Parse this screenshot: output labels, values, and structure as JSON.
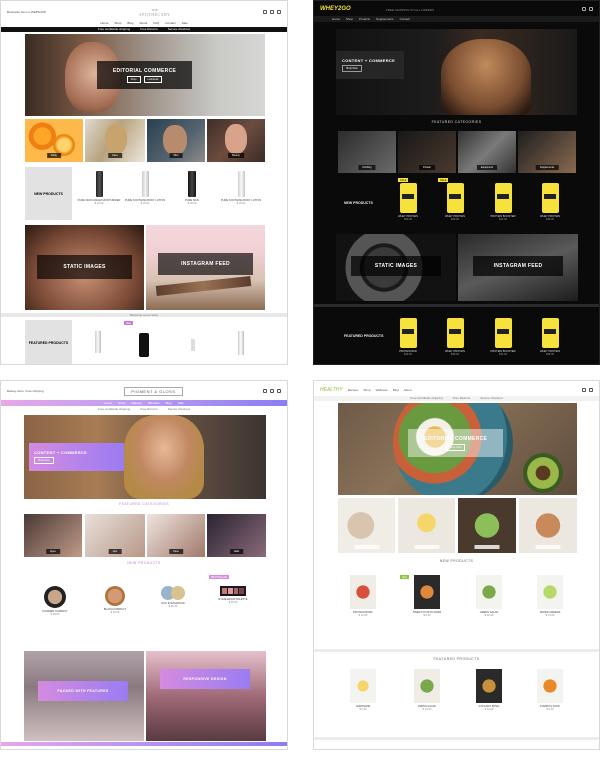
{
  "p1": {
    "header": {
      "left_text": "Bestseller Item in WEBSHOP",
      "logo_line1": "THE",
      "logo_line2": "APOTHECARY"
    },
    "nav": [
      "Home",
      "Shop",
      "Blog",
      "About",
      "FAQ",
      "Contact",
      "Sale"
    ],
    "notice": [
      "Free worldwide shipping",
      "Free Returns",
      "Secure checkout"
    ],
    "hero_title": "EDITORIAL COMMERCE",
    "hero_buttons": [
      "Shop",
      "Lookbook"
    ],
    "categories": [
      "Body",
      "Face",
      "Men",
      "Beauty"
    ],
    "new_products_label": "NEW PRODUCTS",
    "products": [
      {
        "name": "PURE SKIN CREAM MOISTURIZER",
        "price": "$ 24.00"
      },
      {
        "name": "PURE SOOTHING BODY LOTION",
        "price": "$ 18.00"
      },
      {
        "name": "PURE SKIN",
        "price": "$ 32.00"
      },
      {
        "name": "PURE SOOTHING BODY LOTION",
        "price": "$ 18.00"
      }
    ],
    "static_images": "STATIC IMAGES",
    "instagram_feed": "INSTAGRAM FEED",
    "strip_text": "Welcome to our store",
    "featured_label": "FEATURED PRODUCTS",
    "featured_badge": "New"
  },
  "p2": {
    "logo": "WHEY2GO",
    "header_small": "FREE SHIPPING ON ALL ORDERS",
    "nav": [
      "Home",
      "Shop",
      "Proteins",
      "Supplements",
      "Contact"
    ],
    "hero_title": "CONTENT + COMMERCE",
    "hero_btn": "Shop Now",
    "featured_categories": "FEATURED CATEGORIES",
    "cats": [
      "Clothing",
      "Protein",
      "Equipment",
      "Supplements"
    ],
    "new_products": "NEW PRODUCTS",
    "badge": "SALE",
    "products": [
      {
        "name": "WHEY PROTEIN",
        "price": "$39.00"
      },
      {
        "name": "WHEY PROTEIN",
        "price": "$39.00"
      },
      {
        "name": "PROTEIN BOOSTER",
        "price": "$42.00"
      },
      {
        "name": "WHEY PROTEIN",
        "price": "$39.00"
      }
    ],
    "static_images": "STATIC IMAGES",
    "instagram_feed": "INSTAGRAM FEED",
    "featured_products": "FEATURED PRODUCTS",
    "featured": [
      {
        "name": "PROTEIN BAR",
        "price": "$29.00"
      },
      {
        "name": "WHEY PROTEIN",
        "price": "$39.00"
      },
      {
        "name": "PROTEIN BOOSTER",
        "price": "$42.00"
      },
      {
        "name": "WHEY PROTEIN",
        "price": "$39.00"
      }
    ]
  },
  "p3": {
    "header_left": "Beauty store, Free shipping",
    "logo": "PIGMENT & GLOSS",
    "nav": [
      "Home",
      "Shop",
      "Makeup",
      "Skincare",
      "Blog",
      "Sale"
    ],
    "notice": [
      "Free worldwide shipping",
      "Free Returns",
      "Secure checkout"
    ],
    "hero_title": "CONTENT + COMMERCE",
    "hero_btn": "Shop Now",
    "featured_categories": "FEATURED CATEGORIES",
    "cats": [
      "Eyes",
      "Lips",
      "Face",
      "Nails"
    ],
    "new_products": "NEW PRODUCTS",
    "badge": "BESTSELLER",
    "products": [
      {
        "name": "POWDER COMPACT",
        "price": "$ 28.00"
      },
      {
        "name": "BLUSH COMPACT",
        "price": "$ 24.00"
      },
      {
        "name": "DUO EYESHADOW",
        "price": "$ 30.00"
      },
      {
        "name": "EYESHADOW PALETTE",
        "price": "$ 45.00"
      }
    ],
    "promo1": "PACKED WITH FEATURES",
    "promo2": "RESPONSIVE DESIGN"
  },
  "p4": {
    "logo": "HEALTHY",
    "nav": [
      "Recipes",
      "Shop",
      "Wellness",
      "Blog",
      "About"
    ],
    "notice": [
      "Free worldwide shipping",
      "Free Returns",
      "Secure checkout"
    ],
    "hero_title": "EDITORIAL COMMERCE",
    "hero_btn": "Shop Now",
    "new_products": "NEW PRODUCTS",
    "badge": "New",
    "products": [
      {
        "name": "PROTEIN BOWL",
        "price": "$ 12.00"
      },
      {
        "name": "SWEET POTATO FRIES",
        "price": "$ 8.00"
      },
      {
        "name": "GREEN SALAD",
        "price": "$ 10.00"
      },
      {
        "name": "SUPER GREENS",
        "price": "$ 14.00"
      }
    ],
    "featured_products": "FEATURED PRODUCTS",
    "featured": [
      {
        "name": "LEMONADE",
        "price": "$ 6.00"
      },
      {
        "name": "FRESH SALAD",
        "price": "$ 10.00"
      },
      {
        "name": "AVOCADO BOWL",
        "price": "$ 12.00"
      },
      {
        "name": "PUMPKIN SOUP",
        "price": "$ 9.00"
      }
    ]
  }
}
